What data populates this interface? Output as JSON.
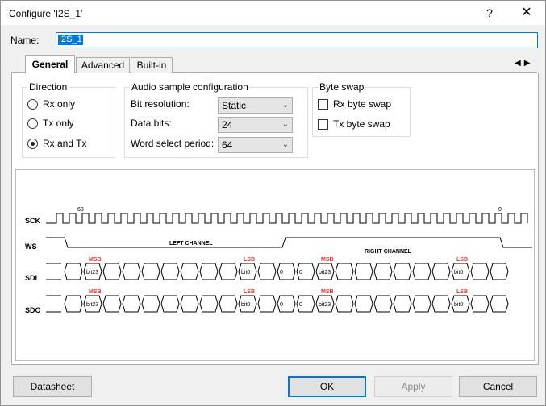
{
  "window": {
    "title": "Configure 'I2S_1'",
    "help_symbol": "?",
    "close_symbol": "✕"
  },
  "name": {
    "label": "Name:",
    "value": "I2S_1"
  },
  "tabs": [
    {
      "label": "General",
      "active": true
    },
    {
      "label": "Advanced",
      "active": false
    },
    {
      "label": "Built-in",
      "active": false
    }
  ],
  "tab_nav": {
    "prev": "◀",
    "next": "▶"
  },
  "direction": {
    "title": "Direction",
    "options": [
      {
        "label": "Rx only",
        "checked": false
      },
      {
        "label": "Tx only",
        "checked": false
      },
      {
        "label": "Rx and Tx",
        "checked": true
      }
    ]
  },
  "audio": {
    "title": "Audio sample configuration",
    "fields": [
      {
        "label": "Bit resolution:",
        "value": "Static"
      },
      {
        "label": "Data bits:",
        "value": "24"
      },
      {
        "label": "Word select period:",
        "value": "64"
      }
    ]
  },
  "byte_swap": {
    "title": "Byte swap",
    "options": [
      {
        "label": "Rx byte swap",
        "checked": false
      },
      {
        "label": "Tx byte swap",
        "checked": false
      }
    ]
  },
  "diagram": {
    "signals": {
      "sck": "SCK",
      "ws": "WS",
      "sdi": "SDI",
      "sdo": "SDO"
    },
    "left_channel": "LEFT CHANNEL",
    "right_channel": "RIGHT CHANNEL",
    "sck_start_label": "63",
    "sck_end_label": "0",
    "msb": "MSB",
    "lsb": "LSB",
    "bit_msb": "bit23",
    "bit_lsb": "bit0",
    "pad_zero": "0",
    "marker_color": "#e03030"
  },
  "buttons": {
    "datasheet": "Datasheet",
    "ok": "OK",
    "apply": "Apply",
    "cancel": "Cancel"
  }
}
